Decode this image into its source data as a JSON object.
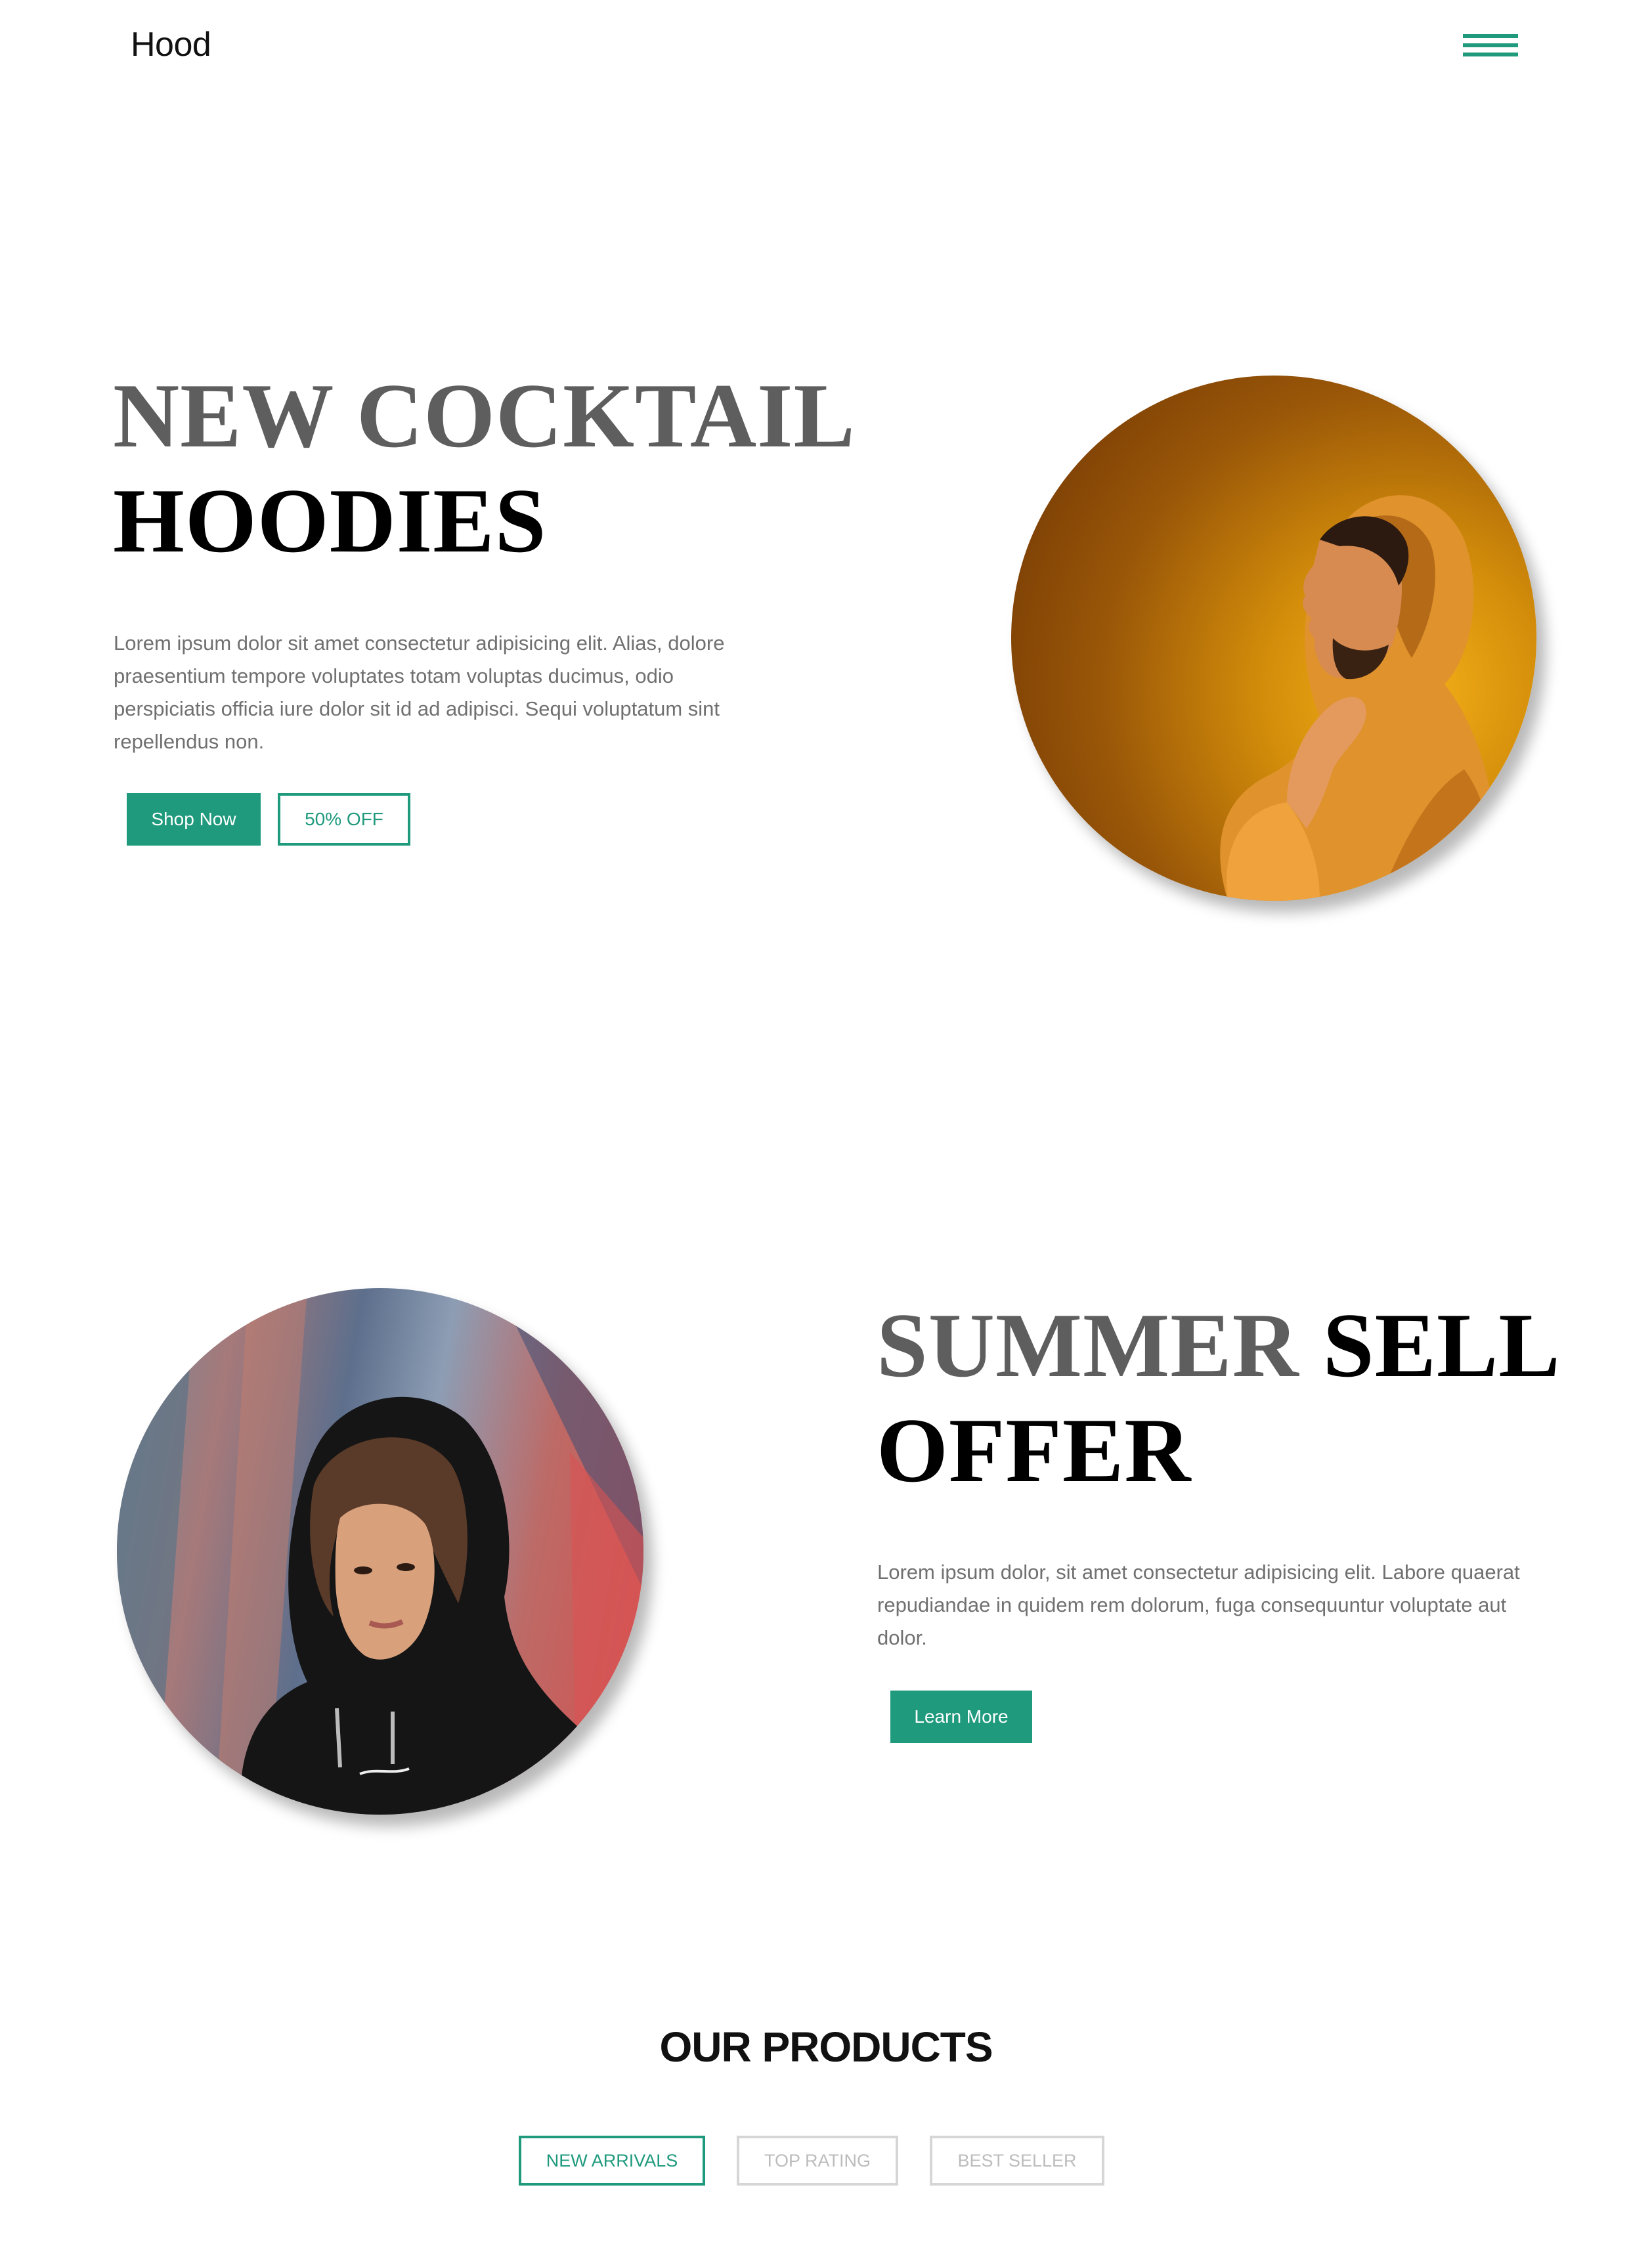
{
  "header": {
    "logo": "Hood",
    "menu_icon": "hamburger-menu-icon"
  },
  "hero": {
    "title_line1": "NEW COCKTAIL",
    "title_line2": "HOODIES",
    "description": "Lorem ipsum dolor sit amet consectetur adipisicing elit. Alias, dolore praesentium tempore voluptates totam voluptas ducimus, odio perspiciatis officia iure dolor sit id ad adipisci. Sequi voluptatum sint repellendus non.",
    "primary_button": "Shop Now",
    "secondary_button": "50% OFF"
  },
  "summer": {
    "title_word1": "SUMMER",
    "title_word2": "SELL",
    "title_line2": "OFFER",
    "description": "Lorem ipsum dolor, sit amet consectetur adipisicing elit. Labore quaerat repudiandae in quidem rem dolorum, fuga consequuntur voluptate aut dolor.",
    "button": "Learn More"
  },
  "products": {
    "title": "OUR PRODUCTS",
    "tabs": [
      {
        "label": "NEW ARRIVALS",
        "active": true
      },
      {
        "label": "TOP RATING",
        "active": false
      },
      {
        "label": "BEST SELLER",
        "active": false
      }
    ]
  },
  "colors": {
    "accent": "#1f9a7d",
    "heading_gray": "#5e5e5e",
    "body_text": "#707070"
  }
}
